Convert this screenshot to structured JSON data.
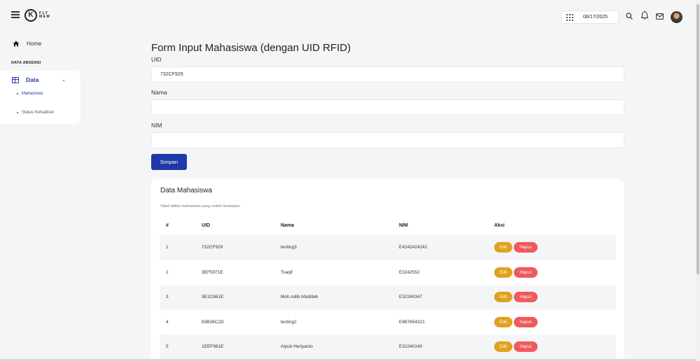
{
  "header": {
    "date": "06/17/2025",
    "logo_mark": "K",
    "logo_text": "FLY MEM"
  },
  "sidebar": {
    "home_label": "Home",
    "section_label": "DATA ABSENSI",
    "data_label": "Data",
    "items": [
      {
        "label": "Mahasiswa"
      },
      {
        "label": "Status Kehadiran"
      }
    ]
  },
  "form": {
    "title": "Form Input Mahasiswa (dengan UID RFID)",
    "uid_label": "UID",
    "uid_value": "732CF929",
    "nama_label": "Nama",
    "nama_value": "",
    "nim_label": "NIM",
    "nim_value": "",
    "submit_label": "Simpan"
  },
  "table": {
    "title": "Data Mahasiswa",
    "subtitle": "Tabel daftar mahasiswa yang sudah tersimpan.",
    "headers": [
      "#",
      "UID",
      "Nama",
      "NIM",
      "Aksi"
    ],
    "edit_label": "Edit",
    "delete_label": "Hapus",
    "rows": [
      {
        "no": "1",
        "uid": "732CF929",
        "nama": "testing3",
        "nim": "E4242424242"
      },
      {
        "no": "2",
        "uid": "3EF5971E",
        "nama": "Tsaqif",
        "nim": "E3242552"
      },
      {
        "no": "3",
        "uid": "9E1C861E",
        "nama": "Moh.Adib Abidillah",
        "nim": "E32240347"
      },
      {
        "no": "4",
        "uid": "83B26C2D",
        "nama": "testing2",
        "nim": "E987654321"
      },
      {
        "no": "5",
        "uid": "1EEF981E",
        "nama": "Aiyub Heriyanto",
        "nim": "E32240140"
      }
    ]
  },
  "colors": {
    "primary": "#1f3aa8",
    "edit": "#e0a21e",
    "delete": "#ef5a5a"
  }
}
